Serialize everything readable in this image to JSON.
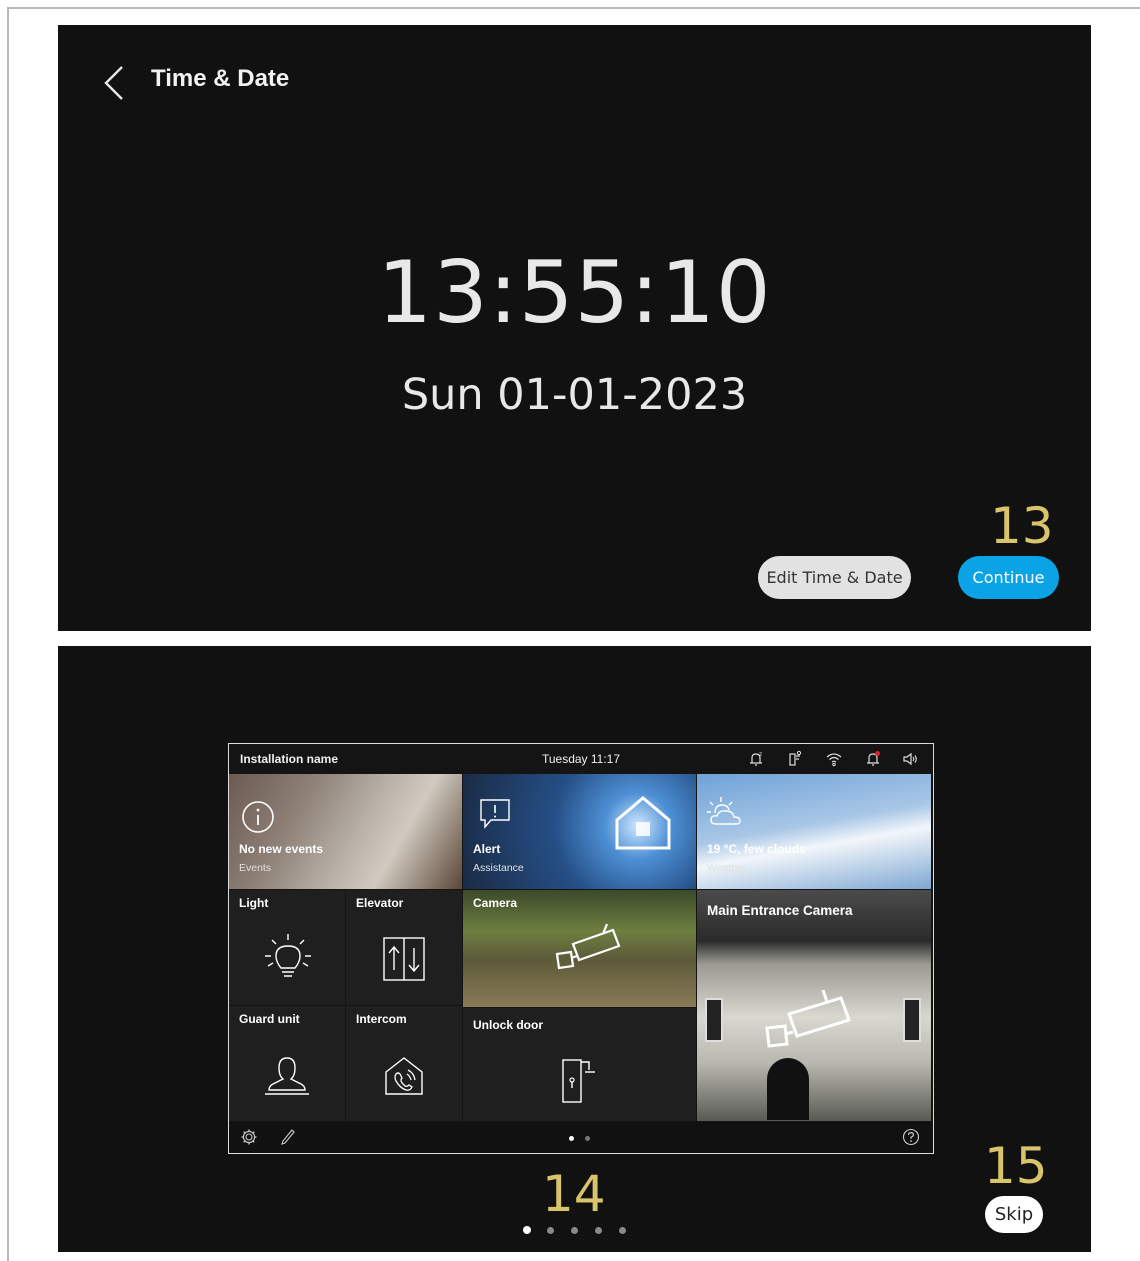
{
  "panel1": {
    "title": "Time & Date",
    "time": "13:55:10",
    "date": "Sun 01-01-2023",
    "callout": "13",
    "edit_button": "Edit Time & Date",
    "continue_button": "Continue",
    "colors": {
      "background": "#111111",
      "continue": "#0aa3e6",
      "callout": "#d8c46a"
    }
  },
  "panel2": {
    "screen": {
      "installation_name": "Installation name",
      "datetime": "Tuesday  11:17",
      "status_icons": [
        "bell-snooze-icon",
        "door-lock-icon",
        "wifi-icon",
        "bell-alert-icon",
        "volume-icon"
      ],
      "tiles": {
        "events": {
          "label": "No new events",
          "sub": "Events",
          "icon": "info-icon"
        },
        "alert": {
          "label": "Alert",
          "sub": "Assistance",
          "icon": "alert-message-icon"
        },
        "weather": {
          "label": "19 °C, few clouds",
          "sub": "Weather",
          "icon": "sun-cloud-icon"
        },
        "light": {
          "label": "Light",
          "icon": "bulb-icon"
        },
        "elevator": {
          "label": "Elevator",
          "icon": "elevator-icon"
        },
        "camera": {
          "label": "Camera",
          "icon": "camera-icon"
        },
        "main_camera": {
          "label": "Main Entrance Camera",
          "icon": "camera-icon"
        },
        "guard": {
          "label": "Guard unit",
          "icon": "guard-person-icon"
        },
        "intercom": {
          "label": "Intercom",
          "icon": "intercom-house-icon"
        },
        "unlock": {
          "label": "Unlock door",
          "icon": "door-unlock-icon"
        }
      },
      "bottom_icons": [
        "gear-icon",
        "pencil-icon",
        "help-icon"
      ],
      "page_dots": {
        "total": 2,
        "active": 1
      }
    },
    "callout_screen": "14",
    "callout_skip": "15",
    "skip_button": "Skip",
    "onboarding_dots": {
      "total": 5,
      "active": 1
    }
  }
}
